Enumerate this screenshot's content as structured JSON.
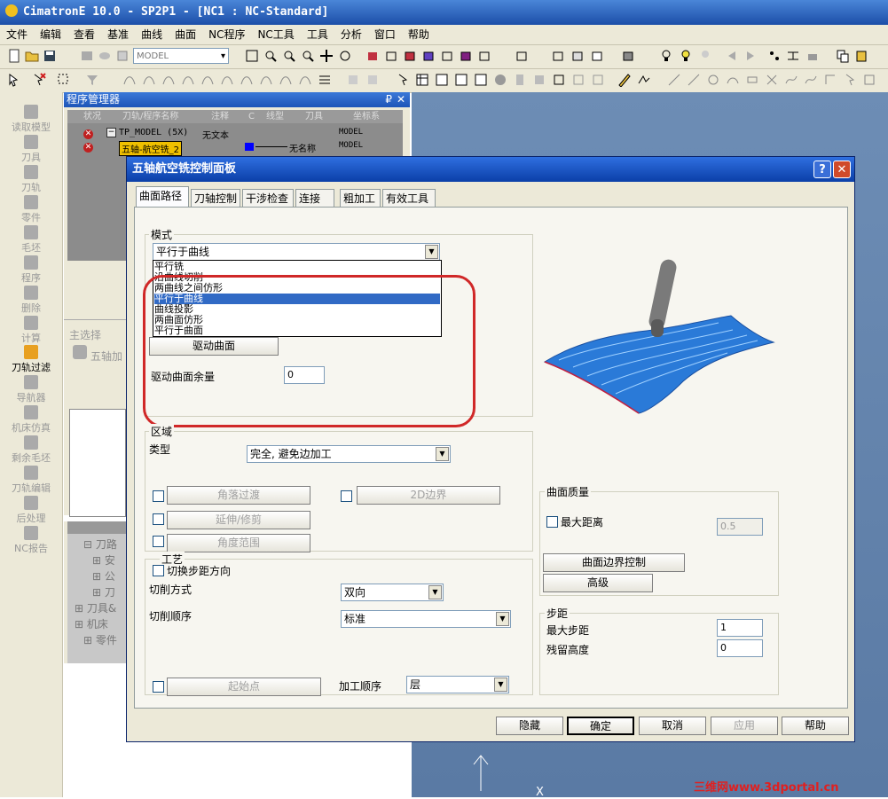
{
  "app": {
    "title": "CimatronE 10.0 - SP2P1 - [NC1 : NC-Standard]"
  },
  "menu": [
    "文件",
    "编辑",
    "查看",
    "基准",
    "曲线",
    "曲面",
    "NC程序",
    "NC工具",
    "工具",
    "分析",
    "窗口",
    "帮助"
  ],
  "toolbar": {
    "model_select": "MODEL"
  },
  "sidebar": {
    "items": [
      "读取模型",
      "刀具",
      "刀轨",
      "零件",
      "毛坯",
      "程序",
      "删除",
      "计算",
      "刀轨过滤",
      "导航器",
      "机床仿真",
      "剩余毛坯",
      "刀轨编辑",
      "后处理",
      "NC报告"
    ],
    "active": "刀轨过滤"
  },
  "program_manager": {
    "title": "程序管理器",
    "pin": "₽",
    "close": "✕",
    "columns": [
      "状况",
      "刀轨/程序名称",
      "注释",
      "C",
      "线型",
      "刀具",
      "坐标系"
    ],
    "rows": [
      {
        "name": "TP_MODEL (5X)",
        "comment": "无文本",
        "tool": "",
        "cs": "MODEL"
      },
      {
        "name": "五轴-航空铣_2",
        "comment": "",
        "tool": "无名称",
        "cs": "MODEL"
      }
    ]
  },
  "selection_pane": {
    "header": "主选择",
    "item": "五轴加"
  },
  "tree_pane": {
    "items": [
      "刀路",
      "安",
      "公",
      "刀",
      "刀具&",
      "机床",
      "零件"
    ]
  },
  "dialog": {
    "title": "五轴航空铣控制面板",
    "help": "?",
    "close": "✕",
    "tabs": [
      "曲面路径",
      "刀轴控制",
      "干涉检查",
      "连接",
      "粗加工",
      "有效工具"
    ],
    "mode": {
      "label": "模式",
      "selected": "平行于曲线",
      "options": [
        "平行铣",
        "沿曲线切削",
        "两曲线之间仿形",
        "平行于曲线",
        "曲线投影",
        "两曲面仿形",
        "平行于曲面"
      ],
      "highlighted_index": 3,
      "drive_surface_button": "驱动曲面",
      "drive_surface_allowance_label": "驱动曲面余量",
      "drive_surface_allowance": "0"
    },
    "region": {
      "label": "区域",
      "type_label": "类型",
      "type_value": "完全, 避免边加工",
      "corner_transition": "角落过渡",
      "boundary_2d": "2D边界",
      "extend_trim": "延伸/修剪",
      "angle_range": "角度范围"
    },
    "process": {
      "label": "工艺",
      "switch_step_direction": "切换步距方向",
      "cut_mode_label": "切削方式",
      "cut_mode_value": "双向",
      "cut_order_label": "切削顺序",
      "cut_order_value": "标准",
      "start_point": "起始点",
      "machining_order_label": "加工顺序",
      "machining_order_value": "层"
    },
    "surface_quality": {
      "label": "曲面质量",
      "max_distance_label": "最大距离",
      "max_distance_value": "0.5",
      "boundary_control_button": "曲面边界控制",
      "advanced_button": "高级"
    },
    "stepover": {
      "label": "步距",
      "max_step_label": "最大步距",
      "max_step_value": "1",
      "scallop_label": "残留高度",
      "scallop_value": "0"
    },
    "buttons": {
      "hide": "隐藏",
      "ok": "确定",
      "cancel": "取消",
      "apply": "应用",
      "help": "帮助"
    }
  },
  "axis_label": "X",
  "watermark": "三维网www.3dportal.cn",
  "colors": {
    "surface": "#2a7ad8",
    "tool": "#7a7a7a",
    "highlight": "#316ac5",
    "ring": "#d02828"
  }
}
